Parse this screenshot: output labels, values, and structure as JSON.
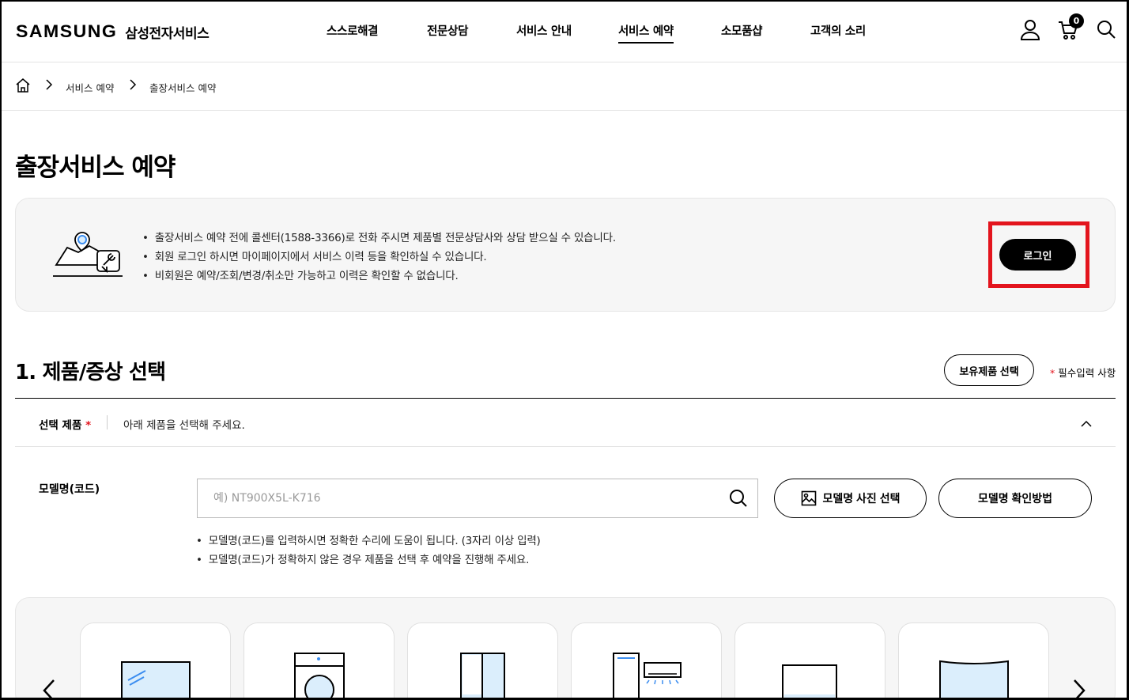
{
  "header": {
    "brand": "SAMSUNG",
    "brand_sub": "삼성전자서비스",
    "nav": [
      "스스로해결",
      "전문상담",
      "서비스 안내",
      "서비스 예약",
      "소모품샵",
      "고객의 소리"
    ],
    "active_nav": "서비스 예약",
    "cart_count": "0"
  },
  "breadcrumb": [
    "서비스 예약",
    "출장서비스 예약"
  ],
  "page_title": "출장서비스 예약",
  "notice": {
    "items": [
      "출장서비스 예약 전에 콜센터(1588-3366)로 전화 주시면 제품별 전문상담사와 상담 받으실 수 있습니다.",
      "회원 로그인 하시면 마이페이지에서 서비스 이력 등을 확인하실 수 있습니다.",
      "비회원은 예약/조회/변경/취소만 가능하고 이력은 확인할 수 없습니다."
    ],
    "login_label": "로그인"
  },
  "section": {
    "title": "1. 제품/증상 선택",
    "owned_button": "보유제품 선택",
    "required_star": "*",
    "required_note": "필수입력 사항",
    "select_label": "선택 제품",
    "select_hint": "아래 제품을 선택해 주세요."
  },
  "model": {
    "label": "모델명(코드)",
    "placeholder": "예) NT900X5L-K716",
    "photo_button": "모델명 사진 선택",
    "howto_button": "모델명 확인방법",
    "notes": [
      "모델명(코드)를 입력하시면 정확한 수리에 도움이 됩니다. (3자리 이상 입력)",
      "모델명(코드)가 정확하지 않은 경우 제품을 선택 후 예약을 진행해 주세요."
    ]
  },
  "colors": {
    "accent": "#e3141d",
    "icon_blue": "#3b8df0",
    "icon_fill": "#dbeefc"
  },
  "icons": [
    "home-icon",
    "user-icon",
    "cart-icon",
    "search-icon",
    "chevron-up-icon",
    "image-icon",
    "chevron-left-icon",
    "chevron-right-icon"
  ]
}
